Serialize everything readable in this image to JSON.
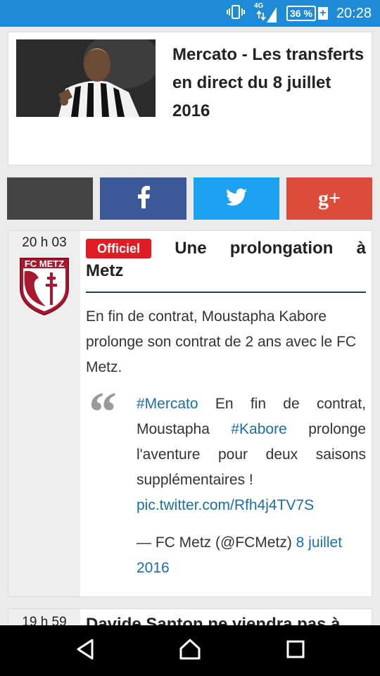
{
  "status_bar": {
    "network": "4G",
    "battery": "36 %",
    "time": "20:28"
  },
  "header": {
    "title": "Mercato - Les transferts en direct du 8 juillet 2016"
  },
  "share_buttons": [
    {
      "name": "generic",
      "color": "#444444"
    },
    {
      "name": "facebook",
      "label": "f",
      "color": "#3b5998"
    },
    {
      "name": "twitter",
      "color": "#1da1f2"
    },
    {
      "name": "google-plus",
      "label": "g+",
      "color": "#dd4b39"
    }
  ],
  "post": {
    "time": "20 h 03",
    "badge": "Officiel",
    "title_line1_words": [
      "Une",
      "prolongation",
      "à"
    ],
    "title_line2": "Metz",
    "summary": "En fin de contrat, Moustapha Kabore prolonge son contrat de 2 ans avec le FC Metz.",
    "quote_mark": "“",
    "tweet": {
      "hashtag1": "#Mercato",
      "text1": " En fin de contrat, Moustapha ",
      "hashtag2": "#Kabore",
      "text2": " prolonge l'aventure pour deux saisons supplémentaires !",
      "link": "pic.twitter.com/Rfh4j4TV7S",
      "signature": "— FC Metz (@FCMetz) ",
      "date_link": "8 juillet 2016"
    },
    "logo_text": "FC METZ"
  },
  "next_post": {
    "time": "19 h 59",
    "title": "Davide Santon ne viendra pas à"
  },
  "colors": {
    "status_bar": "#1f8ad6",
    "badge": "#e01c24",
    "link": "#1b6ea8",
    "rule": "#1e3e62"
  }
}
